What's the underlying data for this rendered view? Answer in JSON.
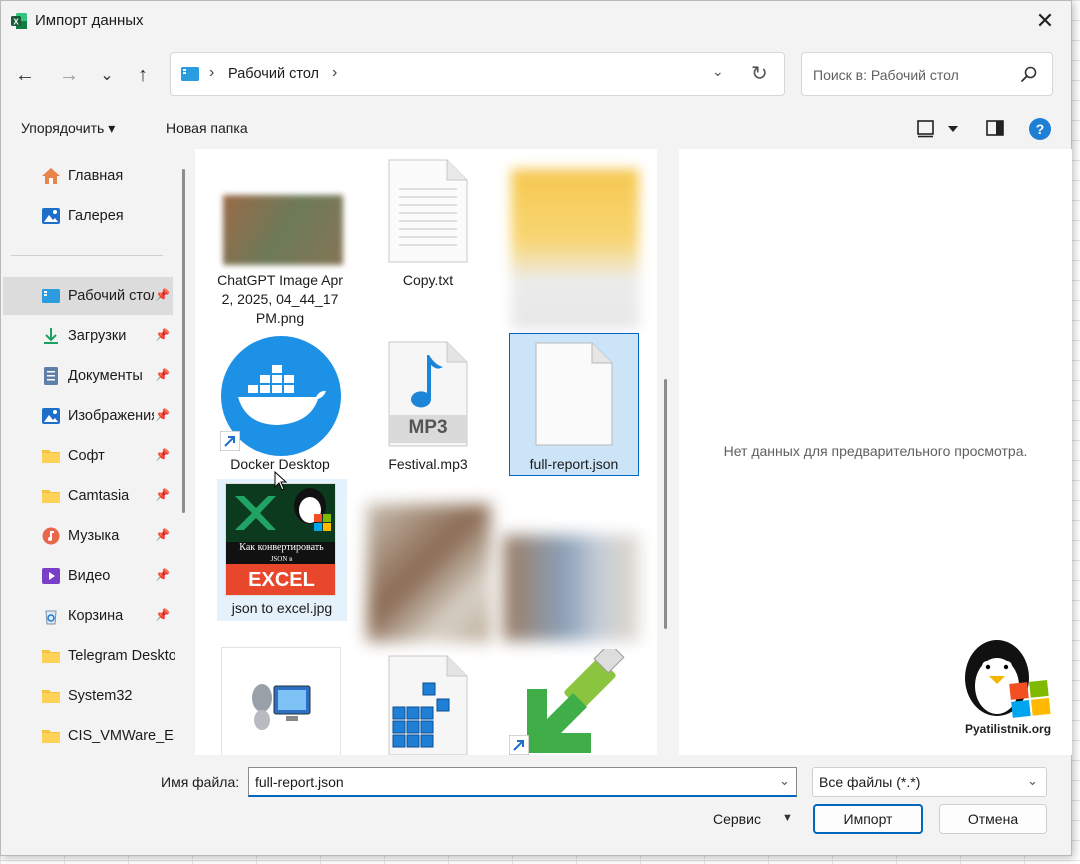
{
  "window": {
    "title": "Импорт данных",
    "close_glyph": "✕"
  },
  "nav": {
    "back": "←",
    "forward": "→",
    "recent": "⌄",
    "up": "↑"
  },
  "address": {
    "sep": "›",
    "path": "Рабочий стол",
    "dropdown": "⌄",
    "refresh": "↻"
  },
  "search": {
    "placeholder": "Поиск в: Рабочий стол"
  },
  "toolbar": {
    "organize": "Упорядочить ▾",
    "new_folder": "Новая папка",
    "help": "?"
  },
  "sidebar": {
    "items": [
      {
        "label": "Главная",
        "icon": "home-icon",
        "pinned": false
      },
      {
        "label": "Галерея",
        "icon": "gallery-icon",
        "pinned": false
      },
      {
        "label": "Рабочий стол",
        "icon": "desktop-icon",
        "pinned": true,
        "active": true
      },
      {
        "label": "Загрузки",
        "icon": "download-icon",
        "pinned": true
      },
      {
        "label": "Документы",
        "icon": "documents-icon",
        "pinned": true
      },
      {
        "label": "Изображения",
        "icon": "pictures-icon",
        "pinned": true
      },
      {
        "label": "Софт",
        "icon": "folder-icon",
        "pinned": true
      },
      {
        "label": "Camtasia",
        "icon": "folder-icon",
        "pinned": true
      },
      {
        "label": "Музыка",
        "icon": "music-icon",
        "pinned": true
      },
      {
        "label": "Видео",
        "icon": "video-icon",
        "pinned": true
      },
      {
        "label": "Корзина",
        "icon": "recycle-bin-icon",
        "pinned": true
      },
      {
        "label": "Telegram Desktop",
        "icon": "folder-icon",
        "pinned": false
      },
      {
        "label": "System32",
        "icon": "folder-icon",
        "pinned": false
      },
      {
        "label": "CIS_VMWare_ESXi",
        "icon": "folder-icon",
        "pinned": false
      }
    ],
    "pin_glyph": "📌"
  },
  "files": [
    {
      "label": "ChatGPT Image Apr 2, 2025, 04_44_17 PM.png",
      "icon": "image-thumbnail"
    },
    {
      "label": "Copy.txt",
      "icon": "text-file-icon"
    },
    {
      "label": "",
      "icon": "blurred-folder"
    },
    {
      "label": "Docker Desktop",
      "icon": "docker-icon"
    },
    {
      "label": "Festival.mp3",
      "icon": "mp3-file-icon",
      "badge": "MP3"
    },
    {
      "label": "full-report.json",
      "icon": "blank-file-icon",
      "selected": true
    },
    {
      "label": "json to excel.jpg",
      "icon": "image-thumbnail",
      "thumb_text": [
        "Как конвертировать",
        "JSON в",
        "EXCEL"
      ]
    },
    {
      "label": "",
      "icon": "blurred-image"
    },
    {
      "label": "",
      "icon": "blurred-image"
    },
    {
      "label": "",
      "icon": "network-computer-icon"
    },
    {
      "label": "",
      "icon": "registry-file-icon"
    },
    {
      "label": "",
      "icon": "usb-installer-icon"
    }
  ],
  "preview": {
    "empty_text": "Нет данных для предварительного просмотра.",
    "watermark": "Pyatilistnik.org"
  },
  "bottom": {
    "filename_label": "Имя файла:",
    "filename_value": "full-report.json",
    "filetype_value": "Все файлы (*.*)",
    "tools_label": "Сервис",
    "import_label": "Импорт",
    "cancel_label": "Отмена"
  },
  "colors": {
    "accent": "#0067c0",
    "selection": "#cce4f7",
    "docker_blue": "#1d91e6",
    "excel_green": "#107c41"
  }
}
